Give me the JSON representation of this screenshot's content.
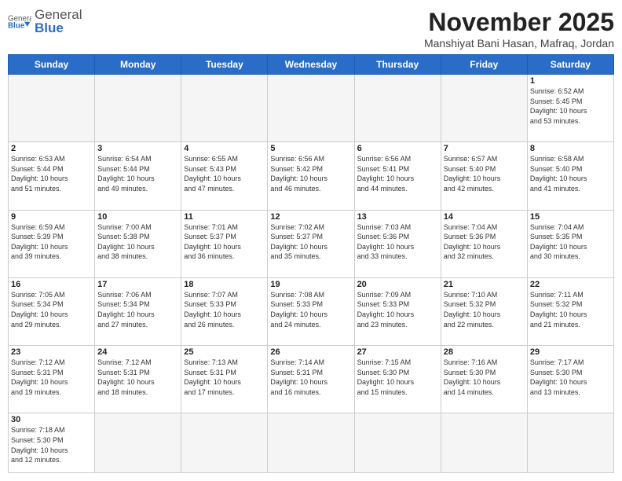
{
  "logo": {
    "text_general": "General",
    "text_blue": "Blue"
  },
  "header": {
    "month_year": "November 2025",
    "location": "Manshiyat Bani Hasan, Mafraq, Jordan"
  },
  "weekdays": [
    "Sunday",
    "Monday",
    "Tuesday",
    "Wednesday",
    "Thursday",
    "Friday",
    "Saturday"
  ],
  "days": [
    {
      "num": "",
      "info": ""
    },
    {
      "num": "",
      "info": ""
    },
    {
      "num": "",
      "info": ""
    },
    {
      "num": "",
      "info": ""
    },
    {
      "num": "",
      "info": ""
    },
    {
      "num": "",
      "info": ""
    },
    {
      "num": "1",
      "info": "Sunrise: 6:52 AM\nSunset: 5:45 PM\nDaylight: 10 hours\nand 53 minutes."
    },
    {
      "num": "2",
      "info": "Sunrise: 6:53 AM\nSunset: 5:44 PM\nDaylight: 10 hours\nand 51 minutes."
    },
    {
      "num": "3",
      "info": "Sunrise: 6:54 AM\nSunset: 5:44 PM\nDaylight: 10 hours\nand 49 minutes."
    },
    {
      "num": "4",
      "info": "Sunrise: 6:55 AM\nSunset: 5:43 PM\nDaylight: 10 hours\nand 47 minutes."
    },
    {
      "num": "5",
      "info": "Sunrise: 6:56 AM\nSunset: 5:42 PM\nDaylight: 10 hours\nand 46 minutes."
    },
    {
      "num": "6",
      "info": "Sunrise: 6:56 AM\nSunset: 5:41 PM\nDaylight: 10 hours\nand 44 minutes."
    },
    {
      "num": "7",
      "info": "Sunrise: 6:57 AM\nSunset: 5:40 PM\nDaylight: 10 hours\nand 42 minutes."
    },
    {
      "num": "8",
      "info": "Sunrise: 6:58 AM\nSunset: 5:40 PM\nDaylight: 10 hours\nand 41 minutes."
    },
    {
      "num": "9",
      "info": "Sunrise: 6:59 AM\nSunset: 5:39 PM\nDaylight: 10 hours\nand 39 minutes."
    },
    {
      "num": "10",
      "info": "Sunrise: 7:00 AM\nSunset: 5:38 PM\nDaylight: 10 hours\nand 38 minutes."
    },
    {
      "num": "11",
      "info": "Sunrise: 7:01 AM\nSunset: 5:37 PM\nDaylight: 10 hours\nand 36 minutes."
    },
    {
      "num": "12",
      "info": "Sunrise: 7:02 AM\nSunset: 5:37 PM\nDaylight: 10 hours\nand 35 minutes."
    },
    {
      "num": "13",
      "info": "Sunrise: 7:03 AM\nSunset: 5:36 PM\nDaylight: 10 hours\nand 33 minutes."
    },
    {
      "num": "14",
      "info": "Sunrise: 7:04 AM\nSunset: 5:36 PM\nDaylight: 10 hours\nand 32 minutes."
    },
    {
      "num": "15",
      "info": "Sunrise: 7:04 AM\nSunset: 5:35 PM\nDaylight: 10 hours\nand 30 minutes."
    },
    {
      "num": "16",
      "info": "Sunrise: 7:05 AM\nSunset: 5:34 PM\nDaylight: 10 hours\nand 29 minutes."
    },
    {
      "num": "17",
      "info": "Sunrise: 7:06 AM\nSunset: 5:34 PM\nDaylight: 10 hours\nand 27 minutes."
    },
    {
      "num": "18",
      "info": "Sunrise: 7:07 AM\nSunset: 5:33 PM\nDaylight: 10 hours\nand 26 minutes."
    },
    {
      "num": "19",
      "info": "Sunrise: 7:08 AM\nSunset: 5:33 PM\nDaylight: 10 hours\nand 24 minutes."
    },
    {
      "num": "20",
      "info": "Sunrise: 7:09 AM\nSunset: 5:33 PM\nDaylight: 10 hours\nand 23 minutes."
    },
    {
      "num": "21",
      "info": "Sunrise: 7:10 AM\nSunset: 5:32 PM\nDaylight: 10 hours\nand 22 minutes."
    },
    {
      "num": "22",
      "info": "Sunrise: 7:11 AM\nSunset: 5:32 PM\nDaylight: 10 hours\nand 21 minutes."
    },
    {
      "num": "23",
      "info": "Sunrise: 7:12 AM\nSunset: 5:31 PM\nDaylight: 10 hours\nand 19 minutes."
    },
    {
      "num": "24",
      "info": "Sunrise: 7:12 AM\nSunset: 5:31 PM\nDaylight: 10 hours\nand 18 minutes."
    },
    {
      "num": "25",
      "info": "Sunrise: 7:13 AM\nSunset: 5:31 PM\nDaylight: 10 hours\nand 17 minutes."
    },
    {
      "num": "26",
      "info": "Sunrise: 7:14 AM\nSunset: 5:31 PM\nDaylight: 10 hours\nand 16 minutes."
    },
    {
      "num": "27",
      "info": "Sunrise: 7:15 AM\nSunset: 5:30 PM\nDaylight: 10 hours\nand 15 minutes."
    },
    {
      "num": "28",
      "info": "Sunrise: 7:16 AM\nSunset: 5:30 PM\nDaylight: 10 hours\nand 14 minutes."
    },
    {
      "num": "29",
      "info": "Sunrise: 7:17 AM\nSunset: 5:30 PM\nDaylight: 10 hours\nand 13 minutes."
    },
    {
      "num": "30",
      "info": "Sunrise: 7:18 AM\nSunset: 5:30 PM\nDaylight: 10 hours\nand 12 minutes."
    },
    {
      "num": "",
      "info": ""
    },
    {
      "num": "",
      "info": ""
    },
    {
      "num": "",
      "info": ""
    },
    {
      "num": "",
      "info": ""
    },
    {
      "num": "",
      "info": ""
    },
    {
      "num": "",
      "info": ""
    }
  ]
}
